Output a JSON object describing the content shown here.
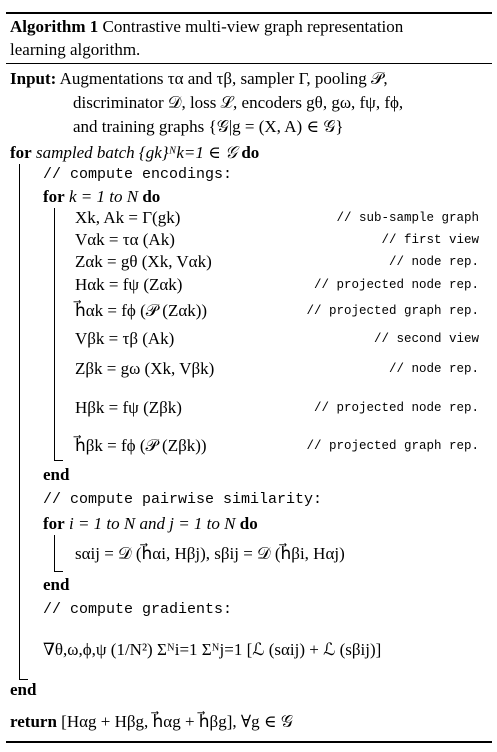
{
  "algorithm": {
    "label": "Algorithm 1",
    "title_line1": "Contrastive multi-view graph representation",
    "title_line2": "learning algorithm.",
    "input_keyword": "Input:",
    "input_lines": [
      "Augmentations τα and τβ, sampler Γ, pooling 𝒫,",
      "discriminator 𝒟, loss ℒ, encoders gθ, gω, fψ, fϕ,",
      "and training graphs {𝒢|g = (X, A) ∈ 𝒢}"
    ],
    "outer_for": {
      "keyword": "for",
      "text": "sampled batch {gk}ᴺk=1 ∈ 𝒢",
      "do": "do"
    },
    "comments": {
      "encodings": "// compute encodings:",
      "similarity": "// compute pairwise similarity:",
      "gradients": "// compute gradients:"
    },
    "for_k": {
      "keyword": "for",
      "text": "k = 1 to N",
      "do": "do"
    },
    "encodings": [
      {
        "expr": "Xk, Ak = Γ(gk)",
        "comment": "// sub-sample graph"
      },
      {
        "expr": "Vαk = τα (Ak)",
        "comment": "// first view"
      },
      {
        "expr": "Zαk = gθ (Xk, Vαk)",
        "comment": "// node rep."
      },
      {
        "expr": "Hαk = fψ (Zαk)",
        "comment": "// projected node rep."
      },
      {
        "expr": "h⃗αk = fϕ (𝒫 (Zαk))",
        "comment": "// projected graph rep."
      },
      {
        "expr": "Vβk = τβ (Ak)",
        "comment": "// second view"
      },
      {
        "expr": "Zβk = gω (Xk, Vβk)",
        "comment": "// node rep."
      },
      {
        "expr": "Hβk = fψ (Zβk)",
        "comment": "// projected node rep."
      },
      {
        "expr": "h⃗βk = fϕ (𝒫 (Zβk))",
        "comment": "// projected graph rep."
      }
    ],
    "end_keyword": "end",
    "for_ij": {
      "keyword": "for",
      "text": "i = 1 to N and j = 1 to N",
      "do": "do"
    },
    "similarity_expr": "sαij = 𝒟 (h⃗αi, Hβj), sβij = 𝒟 (h⃗βi, Hαj)",
    "gradient_expr": "∇θ,ω,ϕ,ψ (1/N²) Σᴺi=1 Σᴺj=1 [ℒ (sαij) + ℒ (sβij)]",
    "return_keyword": "return",
    "return_expr": "[Hαg + Hβg, h⃗αg + h⃗βg], ∀g ∈ 𝒢"
  }
}
